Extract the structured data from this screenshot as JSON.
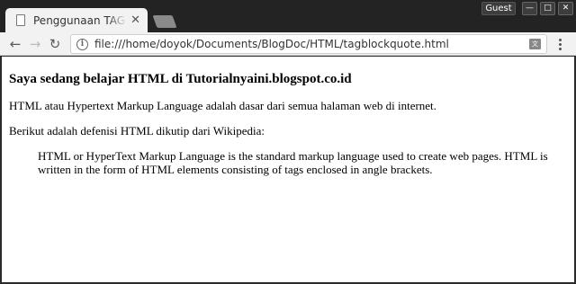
{
  "window": {
    "guest_label": "Guest"
  },
  "tab": {
    "title": "Penggunaan TAG blockquote"
  },
  "address_bar": {
    "url": "file:///home/doyok/Documents/BlogDoc/HTML/tagblockquote.html"
  },
  "page": {
    "heading": "Saya sedang belajar HTML di Tutorialnyaini.blogspot.co.id",
    "paragraph1": "HTML atau Hypertext Markup Language adalah dasar dari semua halaman web di internet.",
    "paragraph2": "Berikut adalah defenisi HTML dikutip dari Wikipedia:",
    "blockquote": "HTML or HyperText Markup Language is the standard markup language used to create web pages. HTML is written in the form of HTML elements consisting of tags enclosed in angle brackets."
  }
}
